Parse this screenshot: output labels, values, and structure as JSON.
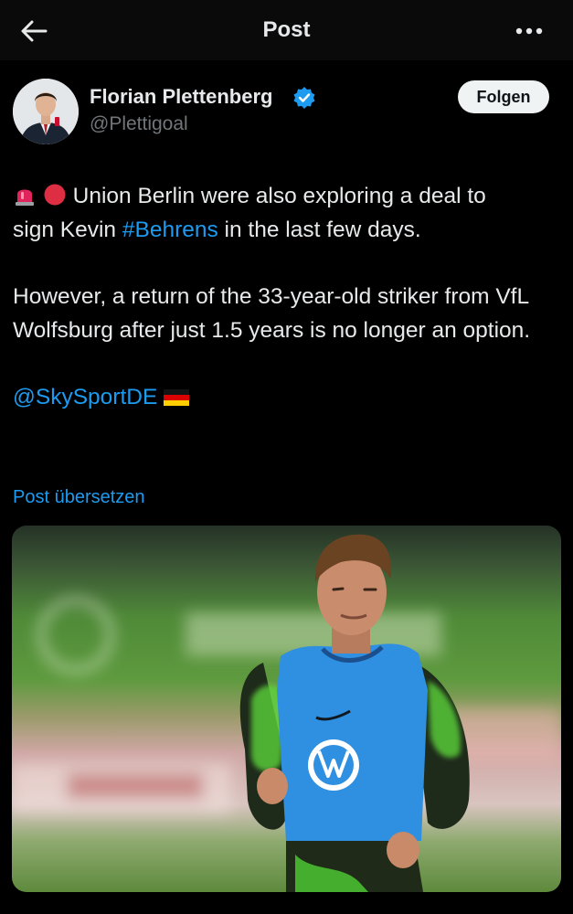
{
  "header": {
    "title": "Post"
  },
  "author": {
    "name": "Florian Plettenberg",
    "handle": "@Plettigoal",
    "follow_label": "Folgen"
  },
  "tweet": {
    "line1": "Union Berlin were also exploring a deal to",
    "line2_prefix": "sign Kevin ",
    "hashtag": "#Behrens",
    "line2_suffix": " in the last few days.",
    "para2": "However, a return of the 33-year-old striker from VfL Wolfsburg after just 1.5 years is no longer an option.",
    "mention": "@SkySportDE",
    "emojis": [
      "siren-emoji",
      "red-circle-emoji",
      "germany-flag-emoji"
    ]
  },
  "translate_label": "Post übersetzen",
  "colors": {
    "background": "#000000",
    "accent": "#1d9bf0",
    "text": "#e7e9ea",
    "muted": "#71767b"
  }
}
